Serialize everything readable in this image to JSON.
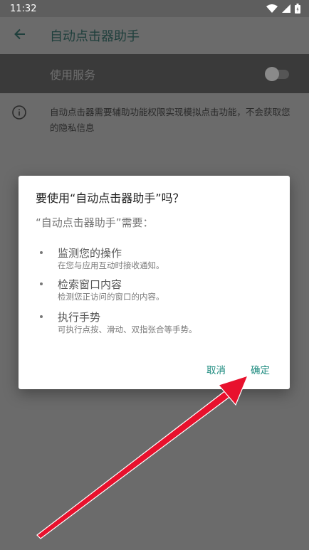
{
  "status_bar": {
    "time": "11:32",
    "icons": [
      "wifi-icon",
      "signal-icon",
      "battery-icon"
    ]
  },
  "app_bar": {
    "back_icon": "arrow-back-icon",
    "title": "自动点击器助手"
  },
  "service": {
    "label": "使用服务",
    "toggle_on": false
  },
  "info": {
    "icon": "info-icon",
    "text": "自动点击器需要辅助功能权限实现模拟点击功能，不会获取您的隐私信息"
  },
  "dialog": {
    "title": "要使用“自动点击器助手”吗？",
    "subtitle": "“自动点击器助手”需要：",
    "permissions": [
      {
        "name": "监测您的操作",
        "desc": "在您与应用互动时接收通知。"
      },
      {
        "name": "检索窗口内容",
        "desc": "检测您正访问的窗口的内容。"
      },
      {
        "name": "执行手势",
        "desc": "可执行点按、滑动、双指张合等手势。"
      }
    ],
    "cancel_label": "取消",
    "ok_label": "确定"
  },
  "colors": {
    "accent": "#1b8a7e",
    "scrim": "#6b6b6b",
    "arrow": "#e8112d"
  }
}
